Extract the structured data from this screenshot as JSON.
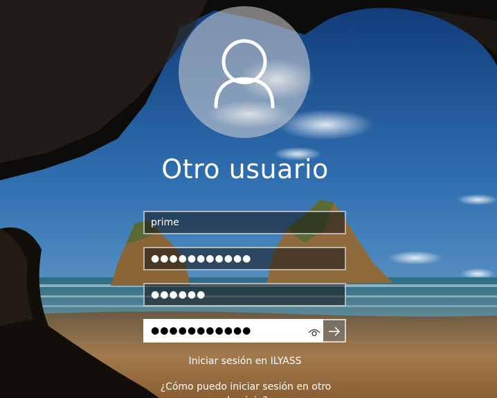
{
  "login": {
    "user_name": "Otro usuario",
    "username_value": "prime",
    "password_1_masked": "●●●●●●●●●●●",
    "password_2_masked": "●●●●●●",
    "password_3_masked": "●●●●●●●●●●●"
  },
  "links": {
    "signin_to_domain": "Iniciar sesión en ILYASS",
    "help": "¿Cómo puedo iniciar sesión en otro dominio?"
  },
  "icons": {
    "avatar": "user-silhouette-icon",
    "reveal": "eye-icon",
    "submit": "arrow-right-icon"
  },
  "colors": {
    "text": "#ffffff",
    "avatar_circle": "#d7d7d7",
    "active_field_bg": "#ffffff"
  }
}
